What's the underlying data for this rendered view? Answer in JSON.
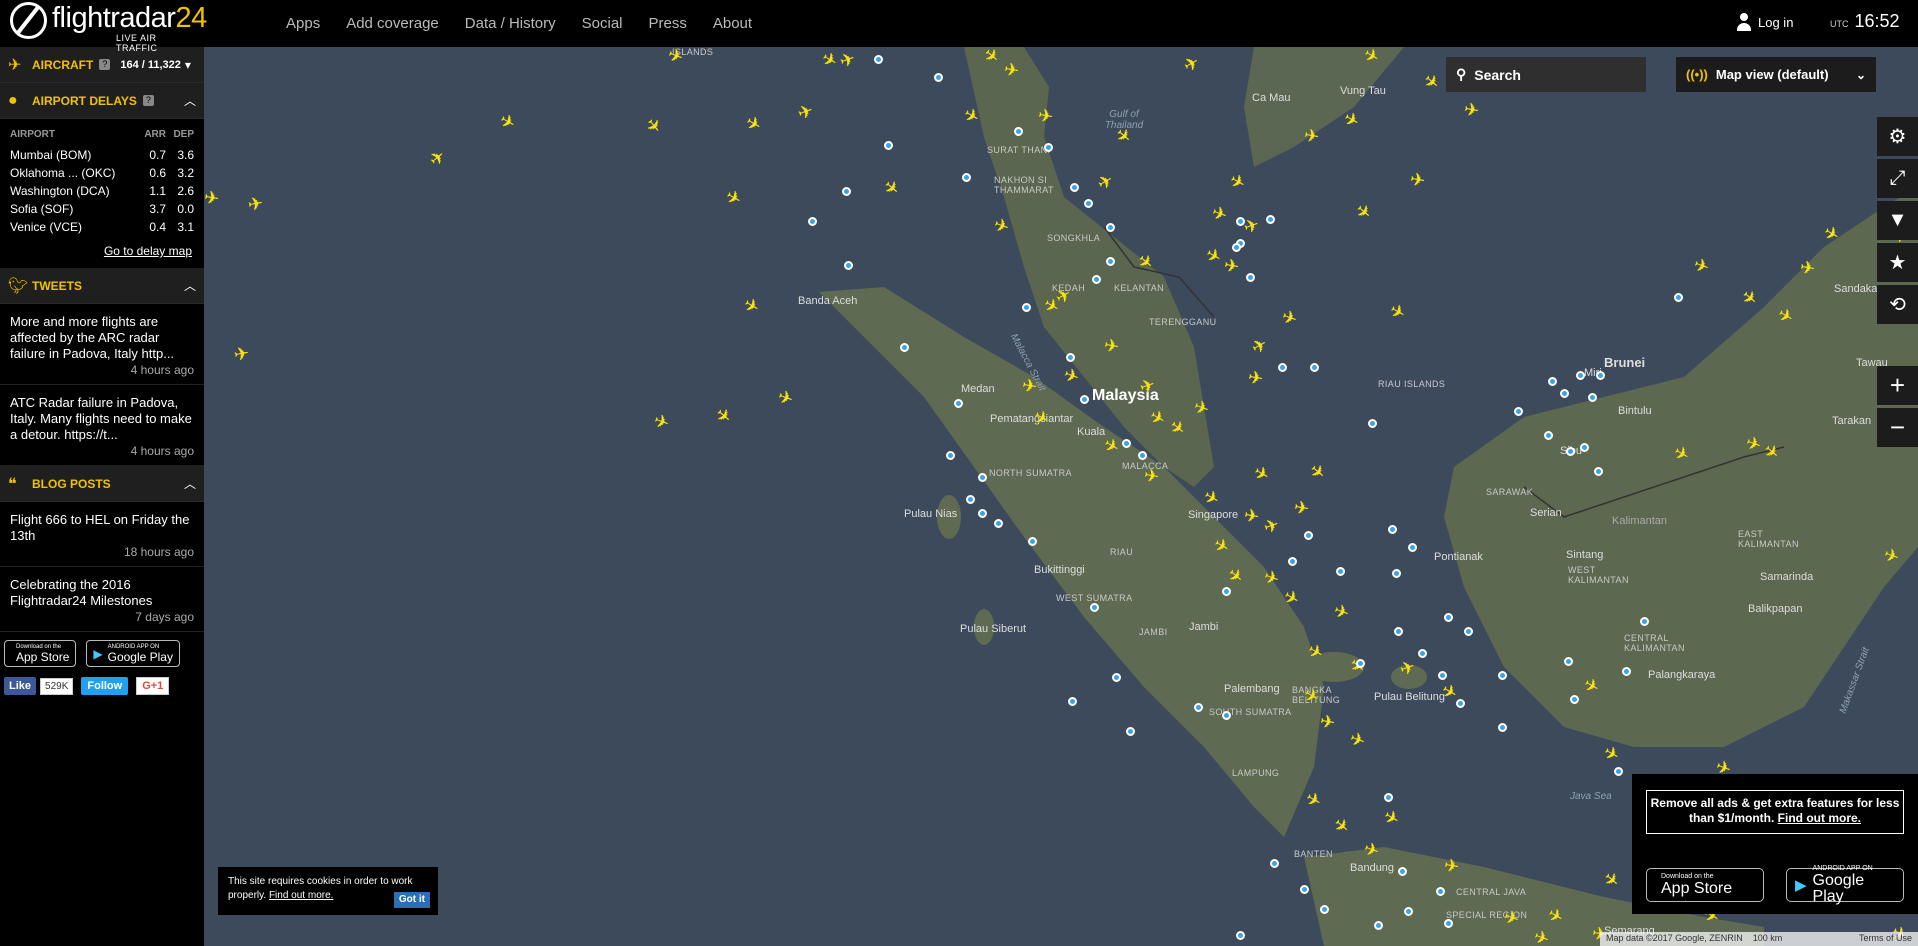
{
  "header": {
    "logo_text": "flightradar",
    "logo_num": "24",
    "logo_sub": "LIVE AIR TRAFFIC",
    "nav": [
      "Apps",
      "Add coverage",
      "Data / History",
      "Social",
      "Press",
      "About"
    ],
    "login_label": "Log in",
    "utc_label": "UTC",
    "time": "16:52"
  },
  "sidebar": {
    "aircraft": {
      "title": "AIRCRAFT",
      "count": "164 / 11,322"
    },
    "delays": {
      "title": "AIRPORT DELAYS",
      "col_airport": "AIRPORT",
      "col_arr": "ARR",
      "col_dep": "DEP",
      "rows": [
        {
          "airport": "Mumbai (BOM)",
          "arr": "0.7",
          "dep": "3.6"
        },
        {
          "airport": "Oklahoma ... (OKC)",
          "arr": "0.6",
          "dep": "3.2"
        },
        {
          "airport": "Washington (DCA)",
          "arr": "1.1",
          "dep": "2.6"
        },
        {
          "airport": "Sofia (SOF)",
          "arr": "3.7",
          "dep": "0.0"
        },
        {
          "airport": "Venice (VCE)",
          "arr": "0.4",
          "dep": "3.1"
        }
      ],
      "link": "Go to delay map"
    },
    "tweets": {
      "title": "TWEETS",
      "items": [
        {
          "text": "More and more flights are affected by the ARC radar failure in Padova, Italy http...",
          "ago": "4 hours ago"
        },
        {
          "text": "ATC Radar failure in Padova, Italy. Many flights need to make a detour. https://t...",
          "ago": "4 hours ago"
        }
      ]
    },
    "blog": {
      "title": "BLOG POSTS",
      "items": [
        {
          "text": "Flight 666 to HEL on Friday the 13th",
          "ago": "18 hours ago"
        },
        {
          "text": "Celebrating the 2016 Flightradar24 Milestones",
          "ago": "7 days ago"
        }
      ]
    },
    "appstore": {
      "small": "Download on the",
      "big": "App Store"
    },
    "googleplay": {
      "small": "ANDROID APP ON",
      "big": "Google Play"
    },
    "fb_like": "Like",
    "fb_count": "529K",
    "tw_follow": "Follow",
    "gplus": "G+1"
  },
  "map": {
    "search_label": "Search",
    "view_label": "Map view (default)",
    "labels": {
      "malaysia": "Malaysia",
      "islands": "ISLANDS",
      "vung_tau": "Vung Tau",
      "ca_mau": "Ca Mau",
      "gulf": "Gulf of Thailand",
      "surat_thani": "SURAT THANI",
      "nakhon": "NAKHON SI THAMMARAT",
      "songkhla": "SONGKHLA",
      "kedah": "KEDAH",
      "kelantan": "KELANTAN",
      "terengganu": "TERENGGANU",
      "banda_aceh": "Banda Aceh",
      "medan": "Medan",
      "pematangsiantar": "Pematangsiantar",
      "north_sumatra": "NORTH SUMATRA",
      "kuala": "Kuala",
      "malacca": "MALACCA",
      "pulau_nias": "Pulau Nias",
      "riau": "RIAU",
      "singapore": "Singapore",
      "bukittinggi": "Bukittinggi",
      "west_sumatra": "WEST SUMATRA",
      "pulau_siberut": "Pulau Siberut",
      "jambi": "JAMBI",
      "jambi_city": "Jambi",
      "palembang": "Palembang",
      "south_sumatra": "SOUTH SUMATRA",
      "bangka": "BANGKA BELITUNG",
      "pulau_belitung": "Pulau Belitung",
      "lampung": "LAMPUNG",
      "banten": "BANTEN",
      "bandung": "Bandung",
      "central_java": "CENTRAL JAVA",
      "special_region": "SPECIAL REGION",
      "riau_islands": "RIAU ISLANDS",
      "malacca_strait": "Malacca Strait",
      "brunei": "Brunei",
      "miri": "Miri",
      "bintulu": "Bintulu",
      "sibu": "Sibu",
      "sarawak": "SARAWAK",
      "serian": "Serian",
      "kalimantan": "Kalimantan",
      "pontianak": "Pontianak",
      "sintang": "Sintang",
      "west_kalimantan": "WEST KALIMANTAN",
      "east_kalimantan": "EAST KALIMANTAN",
      "central_kalimantan": "CENTRAL KALIMANTAN",
      "palangkaraya": "Palangkaraya",
      "samarinda": "Samarinda",
      "balikpapan": "Balikpapan",
      "tarakan": "Tarakan",
      "sandakan": "Sandakan",
      "tawau": "Tawau",
      "makassar_strait": "Makassar Strait",
      "java_sea": "Java Sea",
      "semarang": "Semarang"
    },
    "cookie": {
      "text": "This site requires cookies in order to work properly.",
      "link": "Find out more.",
      "button": "Got it"
    },
    "ad": {
      "text": "Remove all ads & get extra features for less than $1/month.",
      "link": "Find out more.",
      "appstore_small": "Download on the",
      "appstore_big": "App Store",
      "play_small": "ANDROID APP ON",
      "play_big": "Google Play"
    },
    "attribution": {
      "data": "Map data ©2017 Google, ZENRIN",
      "scale": "100 km",
      "terms": "Terms of Use"
    },
    "plane_glyph": "✈",
    "icons": [
      "search-icon",
      "radar-icon",
      "chevron-down-icon",
      "gear-icon",
      "fullscreen-icon",
      "filter-icon",
      "star-icon",
      "playback-icon",
      "zoom-in-icon",
      "zoom-out-icon"
    ]
  }
}
